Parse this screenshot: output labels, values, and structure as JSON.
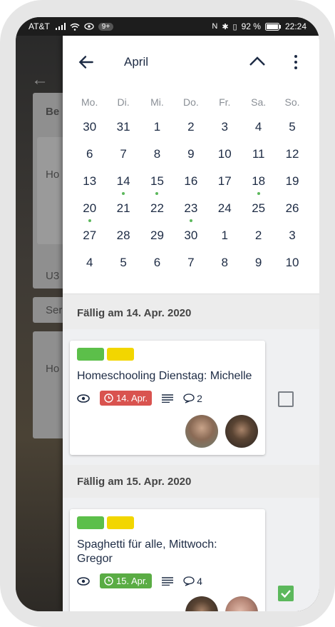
{
  "status_bar": {
    "carrier": "AT&T",
    "notification_count": "9+",
    "battery": "92 %",
    "time": "22:24"
  },
  "background": {
    "items": [
      {
        "text": "Be"
      },
      {
        "text": "Ho"
      },
      {
        "text": "U3"
      },
      {
        "text": "Ser"
      },
      {
        "text": "Ho"
      }
    ]
  },
  "header": {
    "month": "April"
  },
  "calendar": {
    "weekdays": [
      "Mo.",
      "Di.",
      "Mi.",
      "Do.",
      "Fr.",
      "Sa.",
      "So."
    ],
    "weeks": [
      [
        "30",
        "31",
        "1",
        "2",
        "3",
        "4",
        "5"
      ],
      [
        "6",
        "7",
        "8",
        "9",
        "10",
        "11",
        "12"
      ],
      [
        "13",
        "14",
        "15",
        "16",
        "17",
        "18",
        "19"
      ],
      [
        "20",
        "21",
        "22",
        "23",
        "24",
        "25",
        "26"
      ],
      [
        "27",
        "28",
        "29",
        "30",
        "1",
        "2",
        "3"
      ],
      [
        "4",
        "5",
        "6",
        "7",
        "8",
        "9",
        "10"
      ]
    ],
    "dotted_days": [
      "14",
      "15",
      "18",
      "20",
      "23"
    ]
  },
  "sections": [
    {
      "header": "Fällig am 14. Apr. 2020",
      "card": {
        "labels": [
          "#5cbf4a",
          "#f2d600"
        ],
        "title": "Homeschooling Dienstag: Michelle",
        "due": "14. Apr.",
        "due_color": "#d9534f",
        "comments": "2",
        "checked": false
      }
    },
    {
      "header": "Fällig am 15. Apr. 2020",
      "card": {
        "labels": [
          "#5cbf4a",
          "#f2d600"
        ],
        "title": "Spaghetti für alle, Mittwoch: Gregor",
        "due": "15. Apr.",
        "due_color": "#5aac44",
        "comments": "4",
        "checked": true
      }
    }
  ]
}
